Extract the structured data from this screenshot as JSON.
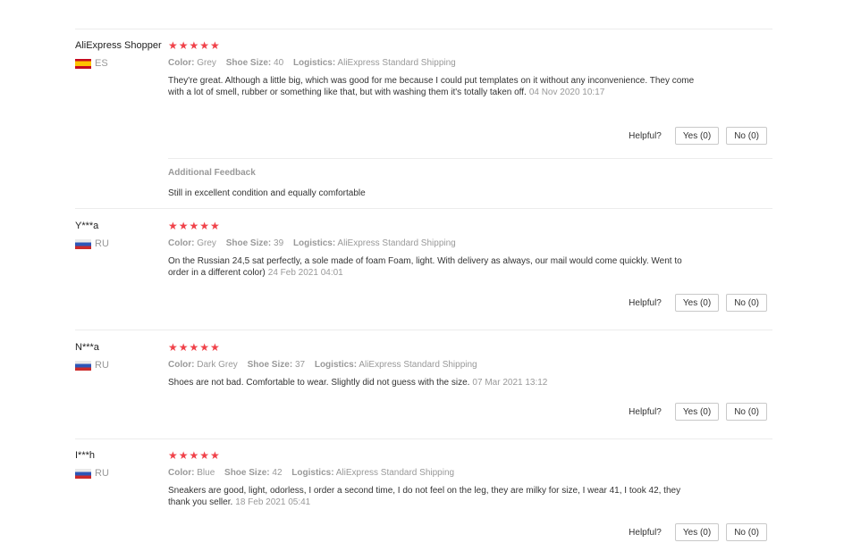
{
  "attr_labels": {
    "color": "Color:",
    "size": "Shoe Size:",
    "logistics": "Logistics:"
  },
  "helpful_label": "Helpful?",
  "reviews": [
    {
      "user": "AliExpress Shopper",
      "country": "ES",
      "stars": "★★★★★",
      "color": "Grey",
      "size": "40",
      "logistics": "AliExpress Standard Shipping",
      "text": "They're great. Although a little big, which was good for me because I could put templates on it without any inconvenience. They come with a lot of smell, rubber or something like that, but with washing them it's totally taken off.",
      "date": "04 Nov 2020 10:17",
      "yes": "Yes (0)",
      "no": "No (0)",
      "additional_title": "Additional Feedback",
      "additional_text": "Still in excellent condition and equally comfortable"
    },
    {
      "user": "Y***a",
      "country": "RU",
      "stars": "★★★★★",
      "color": "Grey",
      "size": "39",
      "logistics": "AliExpress Standard Shipping",
      "text": "On the Russian 24,5 sat perfectly, a sole made of foam Foam, light. With delivery as always, our mail would come quickly. Went to order in a different color)",
      "date": "24 Feb 2021 04:01",
      "yes": "Yes (0)",
      "no": "No (0)"
    },
    {
      "user": "N***a",
      "country": "RU",
      "stars": "★★★★★",
      "color": "Dark Grey",
      "size": "37",
      "logistics": "AliExpress Standard Shipping",
      "text": "Shoes are not bad. Comfortable to wear. Slightly did not guess with the size.",
      "date": "07 Mar 2021 13:12",
      "yes": "Yes (0)",
      "no": "No (0)"
    },
    {
      "user": "I***h",
      "country": "RU",
      "stars": "★★★★★",
      "color": "Blue",
      "size": "42",
      "logistics": "AliExpress Standard Shipping",
      "text": "Sneakers are good, light, odorless, I order a second time, I do not feel on the leg, they are milky for size, I wear 41, I took 42, they thank you seller.",
      "date": "18 Feb 2021 05:41",
      "yes": "Yes (0)",
      "no": "No (0)"
    }
  ]
}
